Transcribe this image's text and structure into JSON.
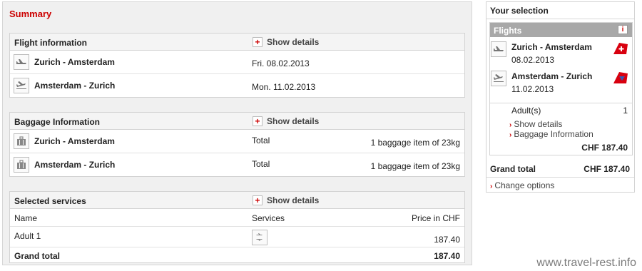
{
  "summary": {
    "title": "Summary",
    "show_details": "Show details",
    "flight_info": {
      "title": "Flight information",
      "rows": [
        {
          "route": "Zurich - Amsterdam",
          "date": "Fri. 08.02.2013"
        },
        {
          "route": "Amsterdam - Zurich",
          "date": "Mon. 11.02.2013"
        }
      ]
    },
    "baggage": {
      "title": "Baggage Information",
      "rows": [
        {
          "route": "Zurich - Amsterdam",
          "label": "Total",
          "value": "1 baggage item of 23kg"
        },
        {
          "route": "Amsterdam - Zurich",
          "label": "Total",
          "value": "1 baggage item of 23kg"
        }
      ]
    },
    "services": {
      "title": "Selected services",
      "headers": {
        "name": "Name",
        "services": "Services",
        "price": "Price in CHF"
      },
      "row": {
        "name": "Adult 1",
        "price": "187.40"
      },
      "total": {
        "label": "Grand total",
        "value": "187.40"
      }
    }
  },
  "selection": {
    "title": "Your selection",
    "flights_label": "Flights",
    "info_glyph": "i",
    "flights": [
      {
        "route": "Zurich - Amsterdam",
        "date": "08.02.2013"
      },
      {
        "route": "Amsterdam - Zurich",
        "date": "11.02.2013"
      }
    ],
    "passenger": {
      "label": "Adult(s)",
      "count": "1"
    },
    "links": [
      "Show details",
      "Baggage Information"
    ],
    "subtotal": "CHF 187.40",
    "grand_total": {
      "label": "Grand total",
      "value": "CHF 187.40"
    },
    "change_options": "Change options"
  },
  "watermark": "www.travel-rest.info",
  "colors": {
    "accent": "#cc0000",
    "panel_bg": "#f0f0f0",
    "flights_bar": "#a8a8a8"
  }
}
